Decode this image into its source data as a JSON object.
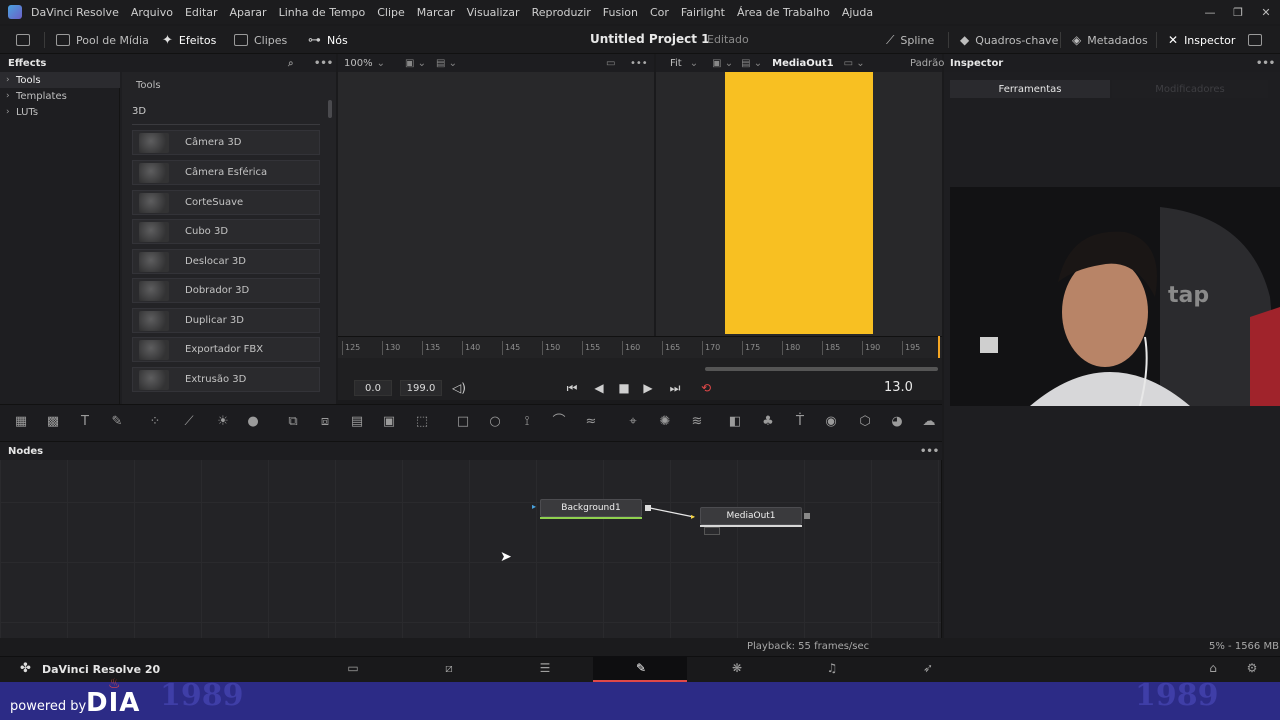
{
  "menubar": {
    "app_name": "DaVinci Resolve",
    "items": [
      "Arquivo",
      "Editar",
      "Aparar",
      "Linha de Tempo",
      "Clipe",
      "Marcar",
      "Visualizar",
      "Reproduzir",
      "Fusion",
      "Cor",
      "Fairlight",
      "Área de Trabalho",
      "Ajuda"
    ]
  },
  "toolbar": {
    "media_pool": "Pool de Mídia",
    "effects": "Efeitos",
    "clips": "Clipes",
    "nodes": "Nós",
    "project_title": "Untitled Project 1",
    "project_state": "Editado",
    "spline": "Spline",
    "keyframes": "Quadros-chave",
    "metadata": "Metadados",
    "inspector": "Inspector"
  },
  "effects_panel": {
    "title": "Effects",
    "tree": [
      "Tools",
      "Templates",
      "LUTs"
    ],
    "list_header": "Tools",
    "category": "3D",
    "items": [
      "Câmera 3D",
      "Câmera Esférica",
      "CorteSuave",
      "Cubo 3D",
      "Deslocar 3D",
      "Dobrador 3D",
      "Duplicar 3D",
      "Exportador FBX",
      "Extrusão 3D"
    ]
  },
  "viewer": {
    "zoom": "100%",
    "fit": "Fit",
    "output_name": "MediaOut1",
    "mode": "Padrão",
    "frame_color": "#f8c022",
    "ruler_ticks": [
      "125",
      "130",
      "135",
      "140",
      "145",
      "150",
      "155",
      "160",
      "165",
      "170",
      "175",
      "180",
      "185",
      "190",
      "195"
    ],
    "start_time": "0.0",
    "end_time": "199.0",
    "current_time": "13.0"
  },
  "inspector": {
    "title": "Inspector",
    "tabs": [
      "Ferramentas",
      "Modificadores"
    ]
  },
  "nodes_panel": {
    "title": "Nodes",
    "nodes": [
      "Background1",
      "MediaOut1"
    ]
  },
  "status": {
    "playback": "Playback: 55 frames/sec",
    "memory": "5% - 1566 MB"
  },
  "pagebar": {
    "app_version": "DaVinci Resolve 20"
  },
  "banner": {
    "powered_by": "powered by",
    "brand": "DIA",
    "deco": "1989"
  },
  "icons": {
    "play": "▶",
    "stop": "■",
    "prev": "◀",
    "skip_start": "⏮",
    "skip_end": "⏭",
    "loop": "⟲",
    "volume": "🔊"
  },
  "colors": {
    "accent_active": "#e04848",
    "node_out_line": "#8fd14f",
    "connection": "#f5d442"
  }
}
